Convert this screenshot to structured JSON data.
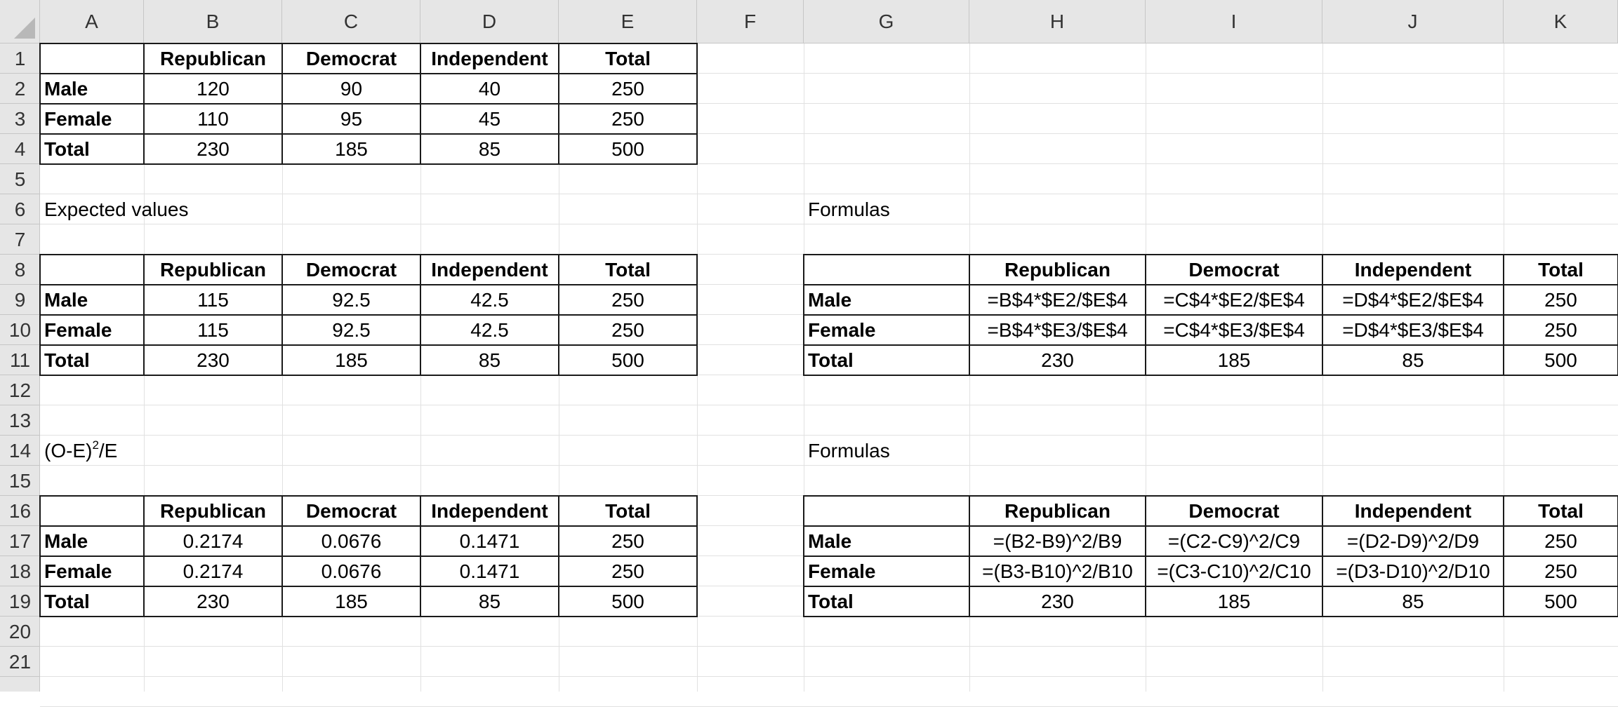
{
  "columns": [
    "A",
    "B",
    "C",
    "D",
    "E",
    "F",
    "G",
    "H",
    "I",
    "J",
    "K"
  ],
  "rows": [
    "1",
    "2",
    "3",
    "4",
    "5",
    "6",
    "7",
    "8",
    "9",
    "10",
    "11",
    "12",
    "13",
    "14",
    "15",
    "16",
    "17",
    "18",
    "19",
    "20",
    "21"
  ],
  "labels": {
    "expected_values": "Expected values",
    "oe_prefix": "(O-E)",
    "oe_sup": "2",
    "oe_suffix": "/E",
    "formulas_1": "Formulas",
    "formulas_2": "Formulas"
  },
  "table_observed": {
    "headers": [
      "Republican",
      "Democrat",
      "Independent",
      "Total"
    ],
    "rows": [
      {
        "label": "Male",
        "values": [
          "120",
          "90",
          "40",
          "250"
        ]
      },
      {
        "label": "Female",
        "values": [
          "110",
          "95",
          "45",
          "250"
        ]
      },
      {
        "label": "Total",
        "values": [
          "230",
          "185",
          "85",
          "500"
        ]
      }
    ]
  },
  "table_expected": {
    "headers": [
      "Republican",
      "Democrat",
      "Independent",
      "Total"
    ],
    "rows": [
      {
        "label": "Male",
        "values": [
          "115",
          "92.5",
          "42.5",
          "250"
        ]
      },
      {
        "label": "Female",
        "values": [
          "115",
          "92.5",
          "42.5",
          "250"
        ]
      },
      {
        "label": "Total",
        "values": [
          "230",
          "185",
          "85",
          "500"
        ]
      }
    ]
  },
  "table_chi": {
    "headers": [
      "Republican",
      "Democrat",
      "Independent",
      "Total"
    ],
    "rows": [
      {
        "label": "Male",
        "values": [
          "0.2174",
          "0.0676",
          "0.1471",
          "250"
        ]
      },
      {
        "label": "Female",
        "values": [
          "0.2174",
          "0.0676",
          "0.1471",
          "250"
        ]
      },
      {
        "label": "Total",
        "values": [
          "230",
          "185",
          "85",
          "500"
        ]
      }
    ]
  },
  "table_expected_formulas": {
    "headers": [
      "Republican",
      "Democrat",
      "Independent",
      "Total"
    ],
    "rows": [
      {
        "label": "Male",
        "values": [
          "=B$4*$E2/$E$4",
          "=C$4*$E2/$E$4",
          "=D$4*$E2/$E$4",
          "250"
        ]
      },
      {
        "label": "Female",
        "values": [
          "=B$4*$E3/$E$4",
          "=C$4*$E3/$E$4",
          "=D$4*$E3/$E$4",
          "250"
        ]
      },
      {
        "label": "Total",
        "values": [
          "230",
          "185",
          "85",
          "500"
        ]
      }
    ]
  },
  "table_chi_formulas": {
    "headers": [
      "Republican",
      "Democrat",
      "Independent",
      "Total"
    ],
    "rows": [
      {
        "label": "Male",
        "values": [
          "=(B2-B9)^2/B9",
          "=(C2-C9)^2/C9",
          "=(D2-D9)^2/D9",
          "250"
        ]
      },
      {
        "label": "Female",
        "values": [
          "=(B3-B10)^2/B10",
          "=(C3-C10)^2/C10",
          "=(D3-D10)^2/D10",
          "250"
        ]
      },
      {
        "label": "Total",
        "values": [
          "230",
          "185",
          "85",
          "500"
        ]
      }
    ]
  }
}
